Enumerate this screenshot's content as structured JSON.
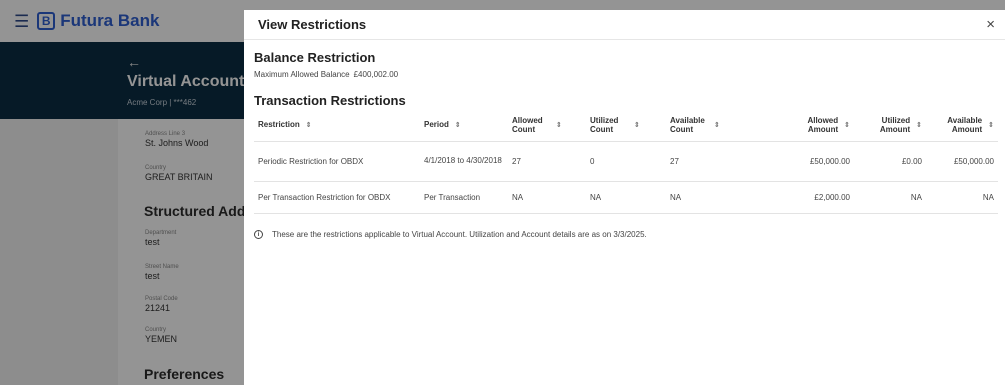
{
  "app": {
    "brand": "Futura Bank",
    "brand_logo_letter": "B"
  },
  "account": {
    "back_arrow": "←",
    "title": "Virtual Account",
    "subtitle": "Acme Corp | ***462"
  },
  "address": {
    "line3_label": "Address Line 3",
    "line3_value": "St. Johns Wood",
    "country_label": "Country",
    "country_value": "GREAT BRITAIN"
  },
  "structured": {
    "heading": "Structured Addr",
    "department_label": "Department",
    "department_value": "test",
    "street_label": "Street Name",
    "street_value": "test",
    "postal_label": "Postal Code",
    "postal_value": "21241",
    "country_label": "Country",
    "country_value": "YEMEN"
  },
  "preferences": {
    "heading": "Preferences"
  },
  "modal": {
    "title": "View Restrictions",
    "close": "×",
    "balance_heading": "Balance Restriction",
    "balance_label": "Maximum Allowed Balance",
    "balance_value": "£400,002.00",
    "transaction_heading": "Transaction Restrictions",
    "columns": [
      "Restriction",
      "Period",
      "Allowed Count",
      "Utilized Count",
      "Available Count",
      "Allowed Amount",
      "Utilized Amount",
      "Available Amount"
    ],
    "rows": [
      [
        "Periodic Restriction for OBDX",
        "4/1/2018 to 4/30/2018",
        "27",
        "0",
        "27",
        "£50,000.00",
        "£0.00",
        "£50,000.00"
      ],
      [
        "Per Transaction Restriction for OBDX",
        "Per Transaction",
        "NA",
        "NA",
        "NA",
        "£2,000.00",
        "NA",
        "NA"
      ]
    ],
    "note": "These are the restrictions applicable to Virtual Account. Utilization and Account details are as on 3/3/2025.",
    "info_glyph": "i"
  },
  "icons": {
    "menu": "hamburger-menu-icon",
    "sort": "sort-icon",
    "info": "info-icon"
  },
  "colors": {
    "brand": "#2f5fd0",
    "hero": "#0c2e44"
  }
}
